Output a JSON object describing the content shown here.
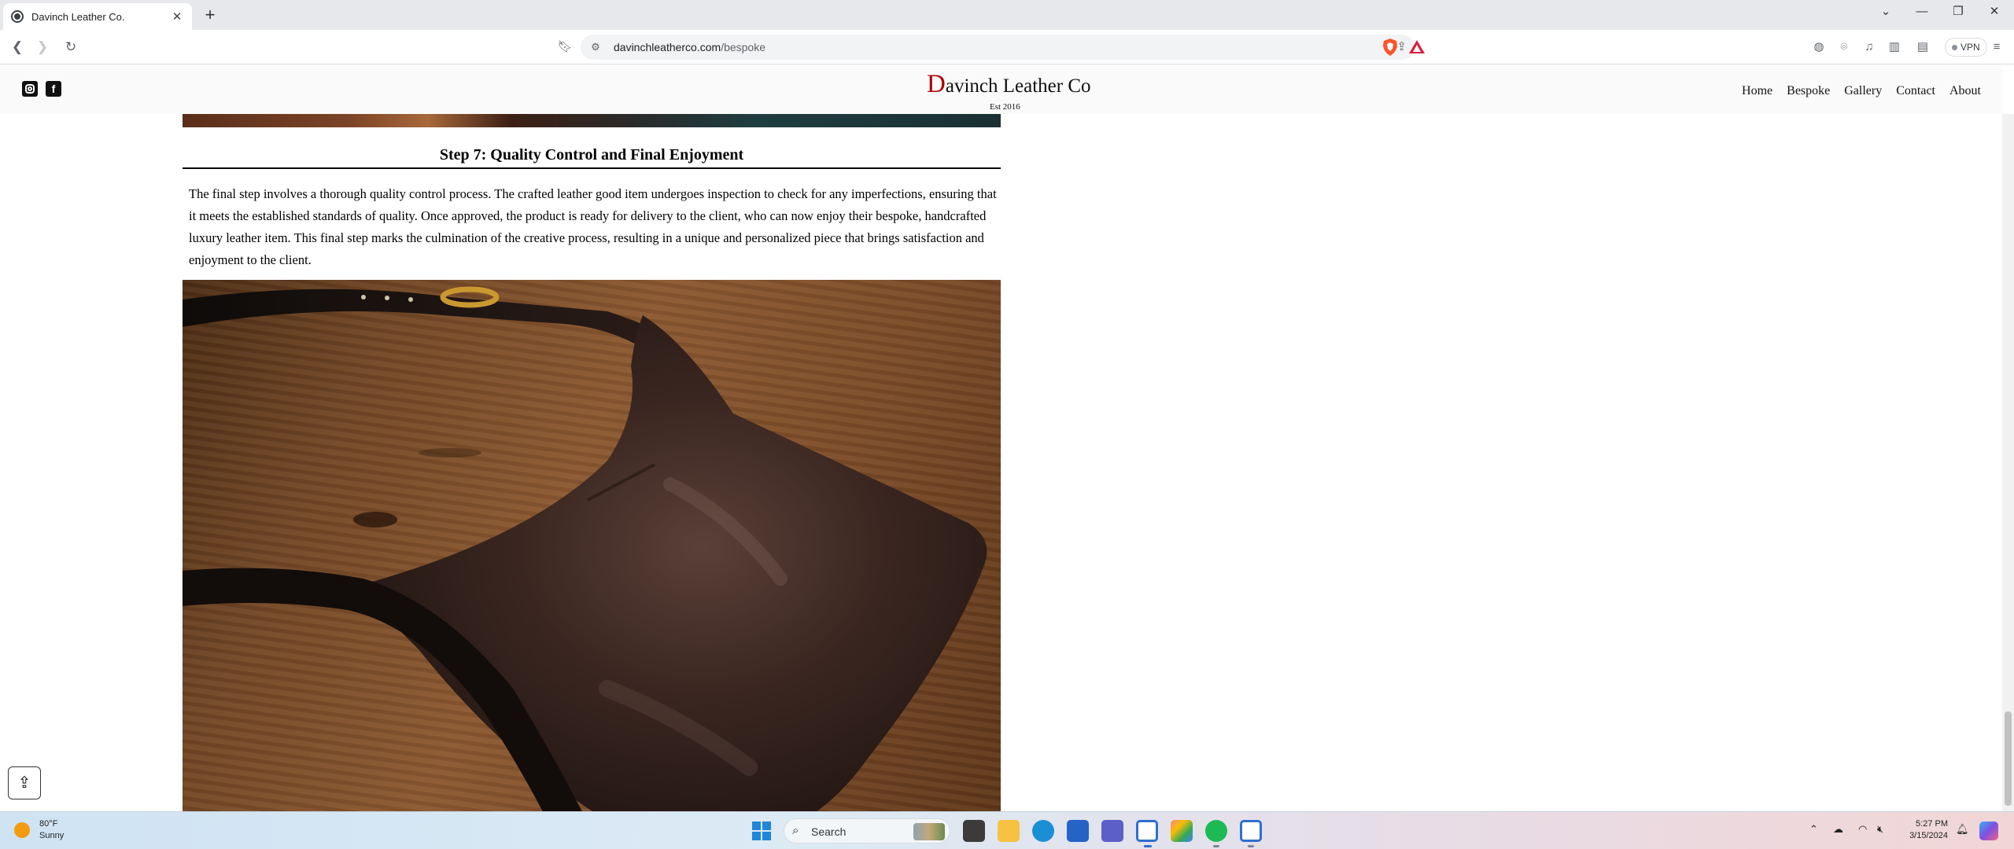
{
  "browser": {
    "tab_title": "Davinch Leather Co.",
    "new_tab_label": "+",
    "url_domain": "davinchleatherco.com",
    "url_path": "/bespoke",
    "vpn_label": "VPN"
  },
  "site": {
    "logo_initial": "D",
    "logo_rest": "avinch Leather Co",
    "established": "Est 2016",
    "nav": [
      "Home",
      "Bespoke",
      "Gallery",
      "Contact",
      "About"
    ]
  },
  "content": {
    "step_title": "Step 7: Quality Control and Final Enjoyment",
    "step_body": "The final step involves a thorough quality control process. The crafted leather good item undergoes inspection to check for any imperfections, ensuring that it meets the established standards of quality. Once approved, the product is ready for delivery to the client, who can now enjoy their bespoke, handcrafted luxury leather item. This final step marks the culmination of the creative process, resulting in a unique and personalized piece that brings satisfaction and enjoyment to the client."
  },
  "taskbar": {
    "weather_temp": "80°F",
    "weather_desc": "Sunny",
    "search_label": "Search",
    "time": "5:27 PM",
    "date": "3/15/2024"
  },
  "colors": {
    "logo_accent": "#b00000",
    "windows_blue": "#1f86d9",
    "spotify_green": "#1db954"
  }
}
